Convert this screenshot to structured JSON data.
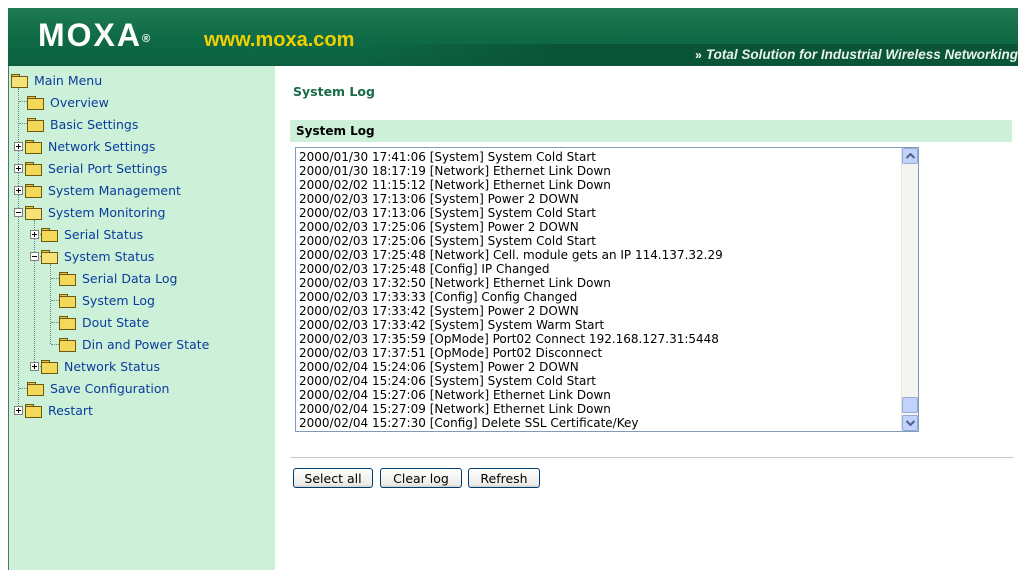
{
  "header": {
    "logo_text": "MOXA",
    "logo_registered": "®",
    "site_url": "www.moxa.com",
    "tagline_arrows": "»",
    "tagline": "Total Solution for Industrial Wireless Networking",
    "colors": {
      "header_green": "#0e6a45",
      "url_yellow": "#f2d000"
    }
  },
  "sidebar": {
    "background": "#ccf0d8",
    "items": [
      {
        "label": "Main Menu",
        "expander": "none",
        "open": true
      },
      {
        "label": "Overview",
        "expander": "none",
        "open": false
      },
      {
        "label": "Basic Settings",
        "expander": "none",
        "open": false
      },
      {
        "label": "Network Settings",
        "expander": "plus",
        "open": false
      },
      {
        "label": "Serial Port Settings",
        "expander": "plus",
        "open": false
      },
      {
        "label": "System Management",
        "expander": "plus",
        "open": false
      },
      {
        "label": "System Monitoring",
        "expander": "minus",
        "open": true
      },
      {
        "label": "Serial Status",
        "expander": "plus",
        "open": false
      },
      {
        "label": "System Status",
        "expander": "minus",
        "open": true
      },
      {
        "label": "Serial Data Log",
        "expander": "none",
        "open": false
      },
      {
        "label": "System Log",
        "expander": "none",
        "open": false
      },
      {
        "label": "Dout State",
        "expander": "none",
        "open": false
      },
      {
        "label": "Din and Power State",
        "expander": "none",
        "open": false
      },
      {
        "label": "Network Status",
        "expander": "plus",
        "open": false
      },
      {
        "label": "Save Configuration",
        "expander": "none",
        "open": false
      },
      {
        "label": "Restart",
        "expander": "plus",
        "open": false
      }
    ]
  },
  "main": {
    "page_title": "System Log",
    "section_title": "System Log",
    "log_lines": [
      "2000/01/30 17:41:06 [System] System Cold Start",
      "2000/01/30 18:17:19 [Network] Ethernet Link Down",
      "2000/02/02 11:15:12 [Network] Ethernet Link Down",
      "2000/02/03 17:13:06 [System] Power 2 DOWN",
      "2000/02/03 17:13:06 [System] System Cold Start",
      "2000/02/03 17:25:06 [System] Power 2 DOWN",
      "2000/02/03 17:25:06 [System] System Cold Start",
      "2000/02/03 17:25:48 [Network] Cell. module gets an IP 114.137.32.29",
      "2000/02/03 17:25:48 [Config] IP Changed",
      "2000/02/03 17:32:50 [Network] Ethernet Link Down",
      "2000/02/03 17:33:33 [Config] Config Changed",
      "2000/02/03 17:33:42 [System] Power 2 DOWN",
      "2000/02/03 17:33:42 [System] System Warm Start",
      "2000/02/03 17:35:59 [OpMode] Port02 Connect 192.168.127.31:5448",
      "2000/02/03 17:37:51 [OpMode] Port02 Disconnect",
      "2000/02/04 15:24:06 [System] Power 2 DOWN",
      "2000/02/04 15:24:06 [System] System Cold Start",
      "2000/02/04 15:27:06 [Network] Ethernet Link Down",
      "2000/02/04 15:27:09 [Network] Ethernet Link Down",
      "2000/02/04 15:27:30 [Config] Delete SSL Certificate/Key"
    ],
    "buttons": {
      "select_all": "Select all",
      "clear_log": "Clear log",
      "refresh": "Refresh"
    }
  }
}
